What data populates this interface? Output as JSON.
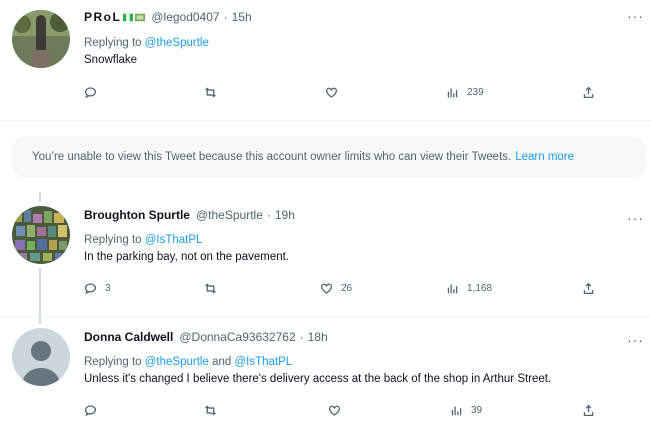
{
  "tweets": [
    {
      "display_name": "PRoL",
      "handle": "@legod0407",
      "time": "15h",
      "replying_prefix": "Replying to",
      "replying_to": [
        "@theSpurtle"
      ],
      "text": "Snowflake",
      "reply_count": "",
      "retweet_count": "",
      "like_count": "",
      "views": "239"
    },
    {
      "display_name": "Broughton Spurtle",
      "handle": "@theSpurtle",
      "time": "19h",
      "replying_prefix": "Replying to",
      "replying_to": [
        "@IsThatPL"
      ],
      "text": "In the parking bay, not on the pavement.",
      "reply_count": "3",
      "retweet_count": "",
      "like_count": "26",
      "views": "1,168"
    },
    {
      "display_name": "Donna Caldwell",
      "handle": "@DonnaCa93632762",
      "time": "18h",
      "replying_prefix": "Replying to",
      "replying_to": [
        "@theSpurtle",
        "@IsThatPL"
      ],
      "replying_join": "and",
      "text": "Unless it's changed I believe there's delivery access at the back of the shop in Arthur Street.",
      "reply_count": "",
      "retweet_count": "",
      "like_count": "",
      "views": "39"
    }
  ],
  "notice": {
    "text": "You’re unable to view this Tweet because this account owner limits who can view their Tweets.",
    "link": "Learn more"
  },
  "colors": {
    "link": "#1d9bf0",
    "muted": "#536471",
    "notice_bg": "#f7f9f9"
  },
  "icons": [
    "reply-icon",
    "retweet-icon",
    "like-icon",
    "views-icon",
    "share-icon",
    "more-icon",
    "flag-icon"
  ]
}
